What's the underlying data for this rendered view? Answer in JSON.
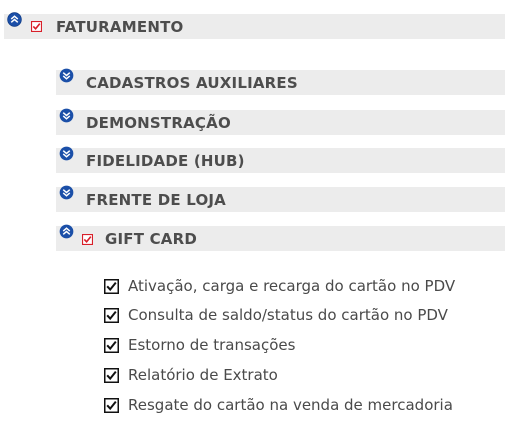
{
  "root": {
    "label": "FATURAMENTO",
    "expanded": true,
    "checked": true
  },
  "groups": [
    {
      "label": "CADASTROS AUXILIARES",
      "expanded": false
    },
    {
      "label": "DEMONSTRAÇÃO",
      "expanded": false
    },
    {
      "label": "FIDELIDADE (HUB)",
      "expanded": false
    },
    {
      "label": "FRENTE DE LOJA",
      "expanded": false
    },
    {
      "label": "GIFT CARD",
      "expanded": true,
      "checked": true
    }
  ],
  "gift_card_items": [
    {
      "label": "Ativação, carga e recarga do cartão no PDV",
      "checked": true
    },
    {
      "label": "Consulta de saldo/status do cartão no PDV",
      "checked": true
    },
    {
      "label": "Estorno de transações",
      "checked": true
    },
    {
      "label": "Relatório de Extrato",
      "checked": true
    },
    {
      "label": "Resgate do cartão na venda de mercadoria",
      "checked": true
    }
  ],
  "colors": {
    "bar_background": "#ececec",
    "label_text": "#4d4d4d",
    "icon_blue": "#1b4fa8",
    "check_red": "#d8202a"
  },
  "icons": {
    "collapse": "chevron-up-circle-icon",
    "expand": "chevron-down-circle-icon",
    "checked_red": "red-checkbox-icon",
    "checked_black": "checkbox-checked-icon"
  }
}
